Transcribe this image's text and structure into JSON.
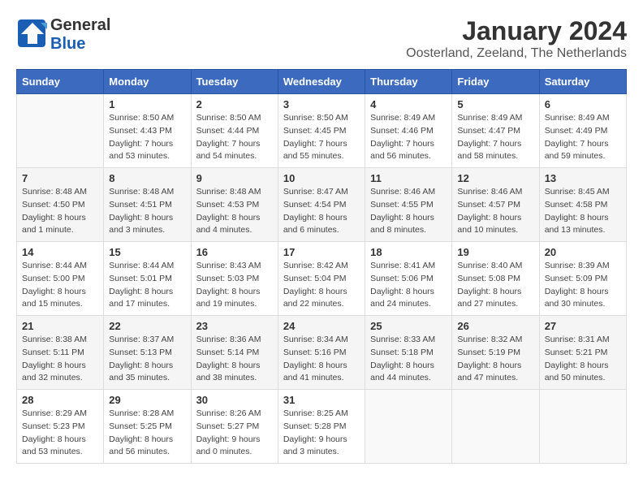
{
  "header": {
    "logo_line1": "General",
    "logo_line2": "Blue",
    "main_title": "January 2024",
    "subtitle": "Oosterland, Zeeland, The Netherlands"
  },
  "columns": [
    "Sunday",
    "Monday",
    "Tuesday",
    "Wednesday",
    "Thursday",
    "Friday",
    "Saturday"
  ],
  "weeks": [
    [
      {
        "day": "",
        "info": ""
      },
      {
        "day": "1",
        "info": "Sunrise: 8:50 AM\nSunset: 4:43 PM\nDaylight: 7 hours\nand 53 minutes."
      },
      {
        "day": "2",
        "info": "Sunrise: 8:50 AM\nSunset: 4:44 PM\nDaylight: 7 hours\nand 54 minutes."
      },
      {
        "day": "3",
        "info": "Sunrise: 8:50 AM\nSunset: 4:45 PM\nDaylight: 7 hours\nand 55 minutes."
      },
      {
        "day": "4",
        "info": "Sunrise: 8:49 AM\nSunset: 4:46 PM\nDaylight: 7 hours\nand 56 minutes."
      },
      {
        "day": "5",
        "info": "Sunrise: 8:49 AM\nSunset: 4:47 PM\nDaylight: 7 hours\nand 58 minutes."
      },
      {
        "day": "6",
        "info": "Sunrise: 8:49 AM\nSunset: 4:49 PM\nDaylight: 7 hours\nand 59 minutes."
      }
    ],
    [
      {
        "day": "7",
        "info": "Sunrise: 8:48 AM\nSunset: 4:50 PM\nDaylight: 8 hours\nand 1 minute."
      },
      {
        "day": "8",
        "info": "Sunrise: 8:48 AM\nSunset: 4:51 PM\nDaylight: 8 hours\nand 3 minutes."
      },
      {
        "day": "9",
        "info": "Sunrise: 8:48 AM\nSunset: 4:53 PM\nDaylight: 8 hours\nand 4 minutes."
      },
      {
        "day": "10",
        "info": "Sunrise: 8:47 AM\nSunset: 4:54 PM\nDaylight: 8 hours\nand 6 minutes."
      },
      {
        "day": "11",
        "info": "Sunrise: 8:46 AM\nSunset: 4:55 PM\nDaylight: 8 hours\nand 8 minutes."
      },
      {
        "day": "12",
        "info": "Sunrise: 8:46 AM\nSunset: 4:57 PM\nDaylight: 8 hours\nand 10 minutes."
      },
      {
        "day": "13",
        "info": "Sunrise: 8:45 AM\nSunset: 4:58 PM\nDaylight: 8 hours\nand 13 minutes."
      }
    ],
    [
      {
        "day": "14",
        "info": "Sunrise: 8:44 AM\nSunset: 5:00 PM\nDaylight: 8 hours\nand 15 minutes."
      },
      {
        "day": "15",
        "info": "Sunrise: 8:44 AM\nSunset: 5:01 PM\nDaylight: 8 hours\nand 17 minutes."
      },
      {
        "day": "16",
        "info": "Sunrise: 8:43 AM\nSunset: 5:03 PM\nDaylight: 8 hours\nand 19 minutes."
      },
      {
        "day": "17",
        "info": "Sunrise: 8:42 AM\nSunset: 5:04 PM\nDaylight: 8 hours\nand 22 minutes."
      },
      {
        "day": "18",
        "info": "Sunrise: 8:41 AM\nSunset: 5:06 PM\nDaylight: 8 hours\nand 24 minutes."
      },
      {
        "day": "19",
        "info": "Sunrise: 8:40 AM\nSunset: 5:08 PM\nDaylight: 8 hours\nand 27 minutes."
      },
      {
        "day": "20",
        "info": "Sunrise: 8:39 AM\nSunset: 5:09 PM\nDaylight: 8 hours\nand 30 minutes."
      }
    ],
    [
      {
        "day": "21",
        "info": "Sunrise: 8:38 AM\nSunset: 5:11 PM\nDaylight: 8 hours\nand 32 minutes."
      },
      {
        "day": "22",
        "info": "Sunrise: 8:37 AM\nSunset: 5:13 PM\nDaylight: 8 hours\nand 35 minutes."
      },
      {
        "day": "23",
        "info": "Sunrise: 8:36 AM\nSunset: 5:14 PM\nDaylight: 8 hours\nand 38 minutes."
      },
      {
        "day": "24",
        "info": "Sunrise: 8:34 AM\nSunset: 5:16 PM\nDaylight: 8 hours\nand 41 minutes."
      },
      {
        "day": "25",
        "info": "Sunrise: 8:33 AM\nSunset: 5:18 PM\nDaylight: 8 hours\nand 44 minutes."
      },
      {
        "day": "26",
        "info": "Sunrise: 8:32 AM\nSunset: 5:19 PM\nDaylight: 8 hours\nand 47 minutes."
      },
      {
        "day": "27",
        "info": "Sunrise: 8:31 AM\nSunset: 5:21 PM\nDaylight: 8 hours\nand 50 minutes."
      }
    ],
    [
      {
        "day": "28",
        "info": "Sunrise: 8:29 AM\nSunset: 5:23 PM\nDaylight: 8 hours\nand 53 minutes."
      },
      {
        "day": "29",
        "info": "Sunrise: 8:28 AM\nSunset: 5:25 PM\nDaylight: 8 hours\nand 56 minutes."
      },
      {
        "day": "30",
        "info": "Sunrise: 8:26 AM\nSunset: 5:27 PM\nDaylight: 9 hours\nand 0 minutes."
      },
      {
        "day": "31",
        "info": "Sunrise: 8:25 AM\nSunset: 5:28 PM\nDaylight: 9 hours\nand 3 minutes."
      },
      {
        "day": "",
        "info": ""
      },
      {
        "day": "",
        "info": ""
      },
      {
        "day": "",
        "info": ""
      }
    ]
  ]
}
